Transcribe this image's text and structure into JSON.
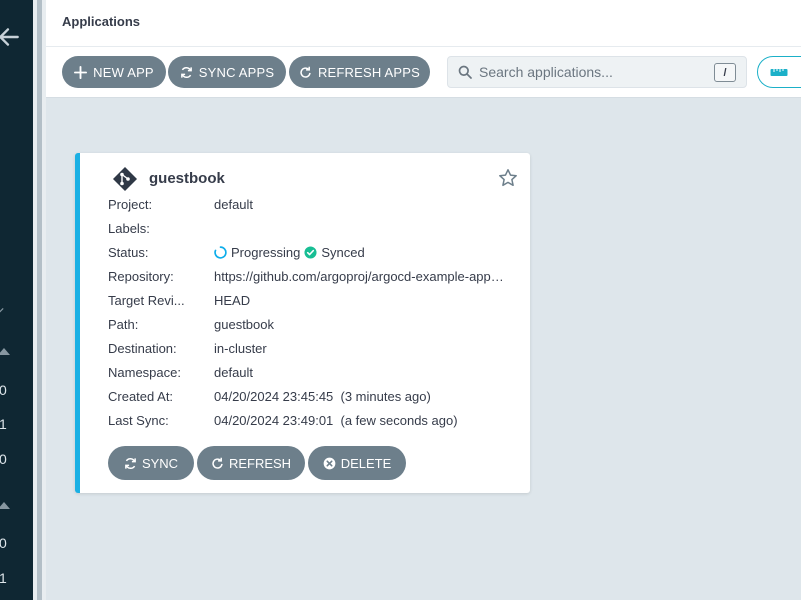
{
  "header": {
    "title": "Applications"
  },
  "nav": {
    "numbers": [
      "0",
      "1",
      "0",
      "0",
      "1"
    ]
  },
  "toolbar": {
    "new_app": "NEW APP",
    "sync_apps": "SYNC APPS",
    "refresh_apps": "REFRESH APPS",
    "search_placeholder": "Search applications...",
    "search_shortcut": "/"
  },
  "app": {
    "name": "guestbook",
    "fields": {
      "project": {
        "label": "Project:",
        "value": "default"
      },
      "labels": {
        "label": "Labels:",
        "value": ""
      },
      "status": {
        "label": "Status:",
        "health": "Progressing",
        "sync": "Synced"
      },
      "repository": {
        "label": "Repository:",
        "value": "https://github.com/argoproj/argocd-example-apps.git"
      },
      "target_revision": {
        "label": "Target Revi...",
        "value": "HEAD"
      },
      "path": {
        "label": "Path:",
        "value": "guestbook"
      },
      "destination": {
        "label": "Destination:",
        "value": "in-cluster"
      },
      "namespace": {
        "label": "Namespace:",
        "value": "default"
      },
      "created_at": {
        "label": "Created At:",
        "value": "04/20/2024 23:45:45  (3 minutes ago)"
      },
      "last_sync": {
        "label": "Last Sync:",
        "value": "04/20/2024 23:49:01  (a few seconds ago)"
      }
    },
    "actions": {
      "sync": "SYNC",
      "refresh": "REFRESH",
      "delete": "DELETE"
    }
  },
  "colors": {
    "accent": "#1bb0e4",
    "button": "#6d7f8b",
    "synced": "#18be94",
    "progressing": "#0dadea",
    "nav_bg": "#0f2733"
  }
}
